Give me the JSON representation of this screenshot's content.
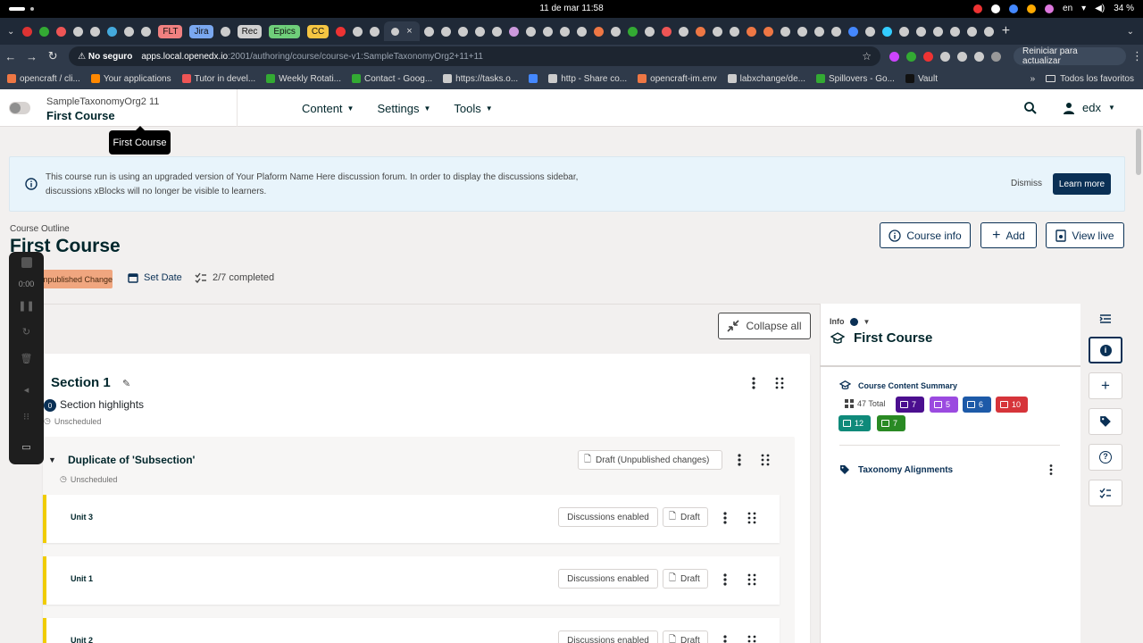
{
  "system": {
    "clock": "11 de mar  11:58",
    "lang": "en",
    "battery": "34 %"
  },
  "tabs": [
    {
      "kind": "icon",
      "color": "#d33"
    },
    {
      "kind": "icon",
      "color": "#3a3"
    },
    {
      "kind": "icon",
      "color": "#e55"
    },
    {
      "kind": "icon",
      "color": "#ccc"
    },
    {
      "kind": "icon",
      "color": "#ccc"
    },
    {
      "kind": "icon",
      "color": "#4ad"
    },
    {
      "kind": "icon",
      "color": "#ccc"
    },
    {
      "kind": "icon",
      "color": "#ccc"
    },
    {
      "kind": "label",
      "label": "FLT",
      "color": "#f08080"
    },
    {
      "kind": "label",
      "label": "Jira",
      "color": "#7aa8f0"
    },
    {
      "kind": "icon",
      "color": "#ccc"
    },
    {
      "kind": "label",
      "label": "Rec",
      "color": "#d0d0d0"
    },
    {
      "kind": "label",
      "label": "Epics",
      "color": "#6fce7a"
    },
    {
      "kind": "label",
      "label": "CC",
      "color": "#f5c542"
    },
    {
      "kind": "icon",
      "color": "#e33"
    },
    {
      "kind": "icon",
      "color": "#ccc"
    },
    {
      "kind": "icon",
      "color": "#ccc"
    },
    {
      "kind": "active",
      "label": "×",
      "color": "#ccc"
    },
    {
      "kind": "icon",
      "color": "#ccc"
    },
    {
      "kind": "icon",
      "color": "#ccc"
    },
    {
      "kind": "icon",
      "color": "#ccc"
    },
    {
      "kind": "icon",
      "color": "#ccc"
    },
    {
      "kind": "icon",
      "color": "#ccc"
    },
    {
      "kind": "icon",
      "color": "#c9d"
    },
    {
      "kind": "icon",
      "color": "#ccc"
    },
    {
      "kind": "icon",
      "color": "#ccc"
    },
    {
      "kind": "icon",
      "color": "#ccc"
    },
    {
      "kind": "icon",
      "color": "#ccc"
    },
    {
      "kind": "icon",
      "color": "#e74"
    },
    {
      "kind": "icon",
      "color": "#ccc"
    },
    {
      "kind": "icon",
      "color": "#3a3"
    },
    {
      "kind": "icon",
      "color": "#ccc"
    },
    {
      "kind": "icon",
      "color": "#e55"
    },
    {
      "kind": "icon",
      "color": "#ccc"
    },
    {
      "kind": "icon",
      "color": "#e74"
    },
    {
      "kind": "icon",
      "color": "#ccc"
    },
    {
      "kind": "icon",
      "color": "#ccc"
    },
    {
      "kind": "icon",
      "color": "#e74"
    },
    {
      "kind": "icon",
      "color": "#e74"
    },
    {
      "kind": "icon",
      "color": "#ccc"
    },
    {
      "kind": "icon",
      "color": "#ccc"
    },
    {
      "kind": "icon",
      "color": "#ccc"
    },
    {
      "kind": "icon",
      "color": "#ccc"
    },
    {
      "kind": "icon",
      "color": "#48f"
    },
    {
      "kind": "icon",
      "color": "#ccc"
    },
    {
      "kind": "icon",
      "color": "#3cf"
    },
    {
      "kind": "icon",
      "color": "#ccc"
    },
    {
      "kind": "icon",
      "color": "#ccc"
    },
    {
      "kind": "icon",
      "color": "#ccc"
    },
    {
      "kind": "icon",
      "color": "#ccc"
    },
    {
      "kind": "icon",
      "color": "#ccc"
    },
    {
      "kind": "icon",
      "color": "#ccc"
    }
  ],
  "address": {
    "insecure_label": "No seguro",
    "host": "apps.local.openedx.io",
    "path": ":2001/authoring/course/course-v1:SampleTaxonomyOrg2+11+11",
    "update_label": "Reiniciar para actualizar"
  },
  "bookmarks": [
    {
      "label": "opencraft / cli...",
      "color": "#e74"
    },
    {
      "label": "Your applications",
      "color": "#f80"
    },
    {
      "label": "Tutor in devel...",
      "color": "#e55"
    },
    {
      "label": "Weekly Rotati...",
      "color": "#3a3"
    },
    {
      "label": "Contact - Goog...",
      "color": "#3a3"
    },
    {
      "label": "https://tasks.o...",
      "color": "#ccc"
    },
    {
      "label": "",
      "color": "#48f"
    },
    {
      "label": "http - Share co...",
      "color": "#ccc"
    },
    {
      "label": "opencraft-im.env",
      "color": "#e74"
    },
    {
      "label": "labxchange/de...",
      "color": "#ccc"
    },
    {
      "label": "Spillovers - Go...",
      "color": "#3a3"
    },
    {
      "label": "Vault",
      "color": "#111"
    }
  ],
  "bookmarks_all": "Todos los favoritos",
  "header": {
    "org": "SampleTaxonomyOrg2 11",
    "course": "First Course",
    "menus": [
      "Content",
      "Settings",
      "Tools"
    ],
    "user": "edx"
  },
  "tooltip": "First Course",
  "alert": {
    "message": "This course run is using an upgraded version of Your Plaform Name Here discussion forum. In order to display the discussions sidebar, discussions xBlocks will no longer be visible to learners.",
    "dismiss": "Dismiss",
    "learn_more": "Learn more"
  },
  "page": {
    "breadcrumb": "Course Outline",
    "title": "First Course",
    "buttons": {
      "info": "Course info",
      "add": "Add",
      "view_live": "View live"
    },
    "status_badge": "Unpublished Changes",
    "set_date": "Set Date",
    "completed": "2/7 completed"
  },
  "recorder": {
    "time": "0:00"
  },
  "outline": {
    "collapse_all": "Collapse all",
    "section": {
      "title": "Section 1",
      "highlights_count": "0",
      "highlights_label": "Section highlights",
      "schedule": "Unscheduled"
    },
    "subsection": {
      "title": "Duplicate of 'Subsection'",
      "status": "Draft (Unpublished changes)",
      "schedule": "Unscheduled"
    },
    "units": [
      {
        "name": "Unit 3",
        "discussions": "Discussions enabled",
        "status": "Draft"
      },
      {
        "name": "Unit 1",
        "discussions": "Discussions enabled",
        "status": "Draft"
      },
      {
        "name": "Unit 2",
        "discussions": "Discussions enabled",
        "status": "Draft"
      }
    ]
  },
  "sidebar": {
    "info_label": "Info",
    "title": "First Course",
    "summary_title": "Course Content Summary",
    "total": "47 Total",
    "chips": [
      {
        "value": "7",
        "color": "#4b0f8f",
        "icon": "video-icon"
      },
      {
        "value": "5",
        "color": "#9b4ae0",
        "icon": "text-icon"
      },
      {
        "value": "6",
        "color": "#1d5aa8",
        "icon": "problem-icon"
      },
      {
        "value": "10",
        "color": "#d6343a",
        "icon": "book-icon"
      },
      {
        "value": "12",
        "color": "#0f8a7a",
        "icon": "list-icon"
      },
      {
        "value": "7",
        "color": "#2a8a24",
        "icon": "camera-icon"
      }
    ],
    "taxonomy": "Taxonomy Alignments"
  }
}
